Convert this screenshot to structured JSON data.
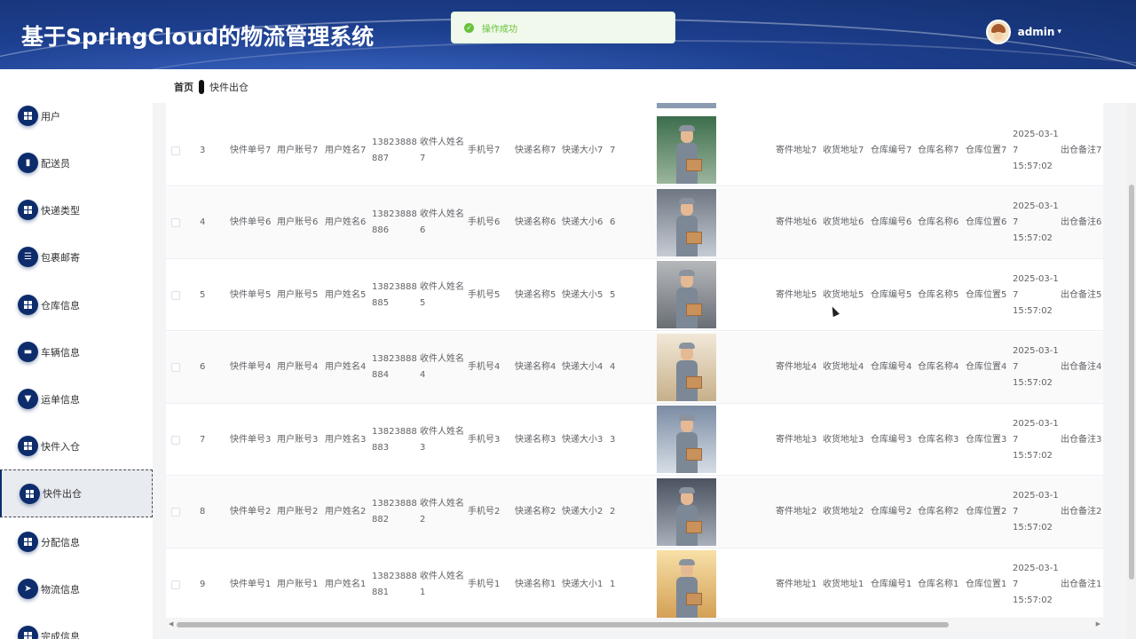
{
  "header": {
    "title": "基于SpringCloud的物流管理系统"
  },
  "user": {
    "name": "admin",
    "caret": "▾"
  },
  "toast": {
    "message": "操作成功",
    "icon": "check-circle-icon",
    "color": "#67c23a"
  },
  "breadcrumb": {
    "home": "首页",
    "current": "快件出仓"
  },
  "colors": {
    "primary": "#0d2c6b",
    "header": "#1d3f8f"
  },
  "sidebar": {
    "items": [
      {
        "label": "用户",
        "icon": "grid-icon"
      },
      {
        "label": "配送员",
        "icon": "person-icon"
      },
      {
        "label": "快递类型",
        "icon": "grid-icon"
      },
      {
        "label": "包裹邮寄",
        "icon": "list-icon"
      },
      {
        "label": "仓库信息",
        "icon": "grid-icon"
      },
      {
        "label": "车辆信息",
        "icon": "monitor-icon"
      },
      {
        "label": "运单信息",
        "icon": "bulb-icon"
      },
      {
        "label": "快件入仓",
        "icon": "grid-icon"
      },
      {
        "label": "快件出仓",
        "icon": "grid-icon",
        "active": true
      },
      {
        "label": "分配信息",
        "icon": "grid-icon"
      },
      {
        "label": "物流信息",
        "icon": "send-icon"
      },
      {
        "label": "完成信息",
        "icon": "grid-icon"
      }
    ]
  },
  "table": {
    "rows": [
      {
        "index": "3",
        "courier_no": "快件单号7",
        "account": "用户账号7",
        "user_name": "用户姓名7",
        "phone": "13823888887",
        "receiver": "收件人姓名7",
        "mobile": "手机号7",
        "express_name": "快递名称7",
        "express_size": "快递大小7",
        "weight": "7",
        "send_addr": "寄件地址7",
        "recv_addr": "收货地址7",
        "wh_no": "仓库编号7",
        "wh_name": "仓库名称7",
        "wh_pos": "仓库位置7",
        "date": "2025-03-17",
        "time": "15:57:02",
        "remark": "出仓备注7",
        "photo": "worker-photo"
      },
      {
        "index": "4",
        "courier_no": "快件单号6",
        "account": "用户账号6",
        "user_name": "用户姓名6",
        "phone": "13823888886",
        "receiver": "收件人姓名6",
        "mobile": "手机号6",
        "express_name": "快递名称6",
        "express_size": "快递大小6",
        "weight": "6",
        "send_addr": "寄件地址6",
        "recv_addr": "收货地址6",
        "wh_no": "仓库编号6",
        "wh_name": "仓库名称6",
        "wh_pos": "仓库位置6",
        "date": "2025-03-17",
        "time": "15:57:02",
        "remark": "出仓备注6",
        "photo": "worker-photo"
      },
      {
        "index": "5",
        "courier_no": "快件单号5",
        "account": "用户账号5",
        "user_name": "用户姓名5",
        "phone": "13823888885",
        "receiver": "收件人姓名5",
        "mobile": "手机号5",
        "express_name": "快递名称5",
        "express_size": "快递大小5",
        "weight": "5",
        "send_addr": "寄件地址5",
        "recv_addr": "收货地址5",
        "wh_no": "仓库编号5",
        "wh_name": "仓库名称5",
        "wh_pos": "仓库位置5",
        "date": "2025-03-17",
        "time": "15:57:02",
        "remark": "出仓备注5",
        "photo": "worker-photo"
      },
      {
        "index": "6",
        "courier_no": "快件单号4",
        "account": "用户账号4",
        "user_name": "用户姓名4",
        "phone": "13823888884",
        "receiver": "收件人姓名4",
        "mobile": "手机号4",
        "express_name": "快递名称4",
        "express_size": "快递大小4",
        "weight": "4",
        "send_addr": "寄件地址4",
        "recv_addr": "收货地址4",
        "wh_no": "仓库编号4",
        "wh_name": "仓库名称4",
        "wh_pos": "仓库位置4",
        "date": "2025-03-17",
        "time": "15:57:02",
        "remark": "出仓备注4",
        "photo": "worker-photo"
      },
      {
        "index": "7",
        "courier_no": "快件单号3",
        "account": "用户账号3",
        "user_name": "用户姓名3",
        "phone": "13823888883",
        "receiver": "收件人姓名3",
        "mobile": "手机号3",
        "express_name": "快递名称3",
        "express_size": "快递大小3",
        "weight": "3",
        "send_addr": "寄件地址3",
        "recv_addr": "收货地址3",
        "wh_no": "仓库编号3",
        "wh_name": "仓库名称3",
        "wh_pos": "仓库位置3",
        "date": "2025-03-17",
        "time": "15:57:02",
        "remark": "出仓备注3",
        "photo": "worker-photo"
      },
      {
        "index": "8",
        "courier_no": "快件单号2",
        "account": "用户账号2",
        "user_name": "用户姓名2",
        "phone": "13823888882",
        "receiver": "收件人姓名2",
        "mobile": "手机号2",
        "express_name": "快递名称2",
        "express_size": "快递大小2",
        "weight": "2",
        "send_addr": "寄件地址2",
        "recv_addr": "收货地址2",
        "wh_no": "仓库编号2",
        "wh_name": "仓库名称2",
        "wh_pos": "仓库位置2",
        "date": "2025-03-17",
        "time": "15:57:02",
        "remark": "出仓备注2",
        "photo": "worker-photo"
      },
      {
        "index": "9",
        "courier_no": "快件单号1",
        "account": "用户账号1",
        "user_name": "用户姓名1",
        "phone": "13823888881",
        "receiver": "收件人姓名1",
        "mobile": "手机号1",
        "express_name": "快递名称1",
        "express_size": "快递大小1",
        "weight": "1",
        "send_addr": "寄件地址1",
        "recv_addr": "收货地址1",
        "wh_no": "仓库编号1",
        "wh_name": "仓库名称1",
        "wh_pos": "仓库位置1",
        "date": "2025-03-17",
        "time": "15:57:02",
        "remark": "出仓备注1",
        "photo": "worker-photo"
      }
    ]
  },
  "scrollbar": {
    "left_arrow": "◀",
    "right_arrow": "▶"
  }
}
